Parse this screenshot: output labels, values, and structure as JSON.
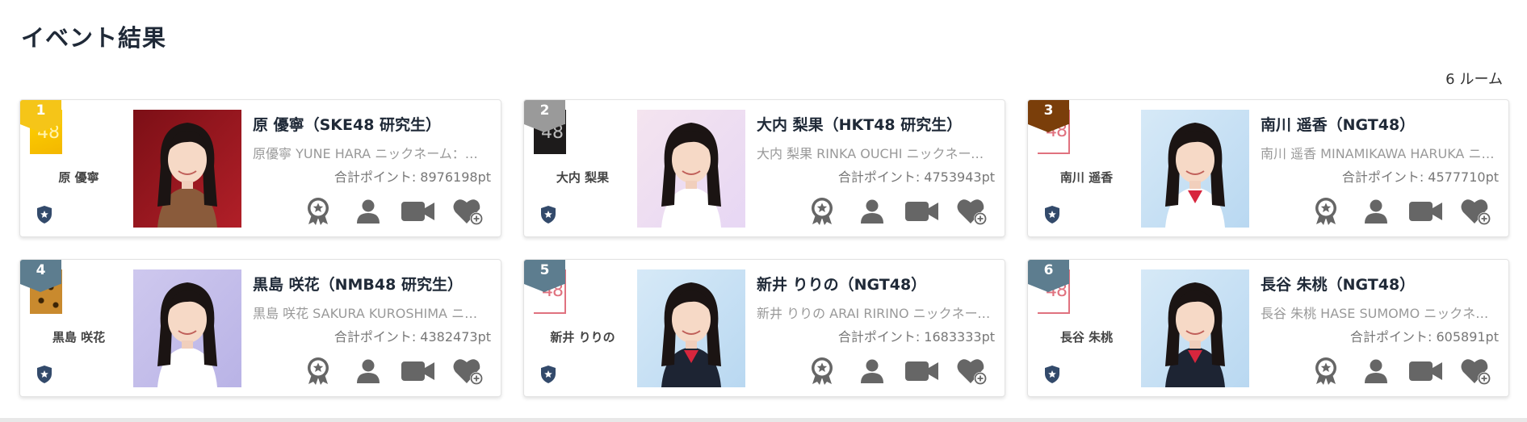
{
  "page": {
    "title": "イベント結果",
    "room_count": "6",
    "room_unit": "ルーム"
  },
  "colors": {
    "rank1": "#f5c518",
    "rank2": "#9a9a9a",
    "rank3": "#7a3e0a",
    "rank_other": "#5d7d8f",
    "icon_gray": "#666666"
  },
  "icons": [
    "star-badge-icon",
    "award-icon",
    "profile-icon",
    "video-camera-icon",
    "heart-plus-icon"
  ],
  "cards": [
    {
      "rank": "1",
      "left_name": "原 優寧",
      "name": "原 優寧（SKE48 研究生）",
      "desc": "原優寧 YUNE HARA ニックネーム：ゆね 出身地：愛知県",
      "points": "合計ポイント: 8976198pt"
    },
    {
      "rank": "2",
      "left_name": "大内 梨果",
      "name": "大内 梨果（HKT48 研究生）",
      "desc": "大内 梨果 RINKA OUCHI ニックネーム：りんか",
      "points": "合計ポイント: 4753943pt"
    },
    {
      "rank": "3",
      "left_name": "南川 遥香",
      "name": "南川 遥香（NGT48）",
      "desc": "南川 遥香 MINAMIKAWA HARUKA ニックネーム",
      "points": "合計ポイント: 4577710pt"
    },
    {
      "rank": "4",
      "left_name": "黒島 咲花",
      "name": "黒島 咲花（NMB48 研究生）",
      "desc": "黒島 咲花 SAKURA KUROSHIMA ニックネーム",
      "points": "合計ポイント: 4382473pt"
    },
    {
      "rank": "5",
      "left_name": "新井 りりの",
      "name": "新井 りりの（NGT48）",
      "desc": "新井 りりの ARAI RIRINO ニックネーム：りりの",
      "points": "合計ポイント: 1683333pt"
    },
    {
      "rank": "6",
      "left_name": "長谷 朱桃",
      "name": "長谷 朱桃（NGT48）",
      "desc": "長谷 朱桃 HASE SUMOMO ニックネーム：すもも",
      "points": "合計ポイント: 605891pt"
    }
  ]
}
